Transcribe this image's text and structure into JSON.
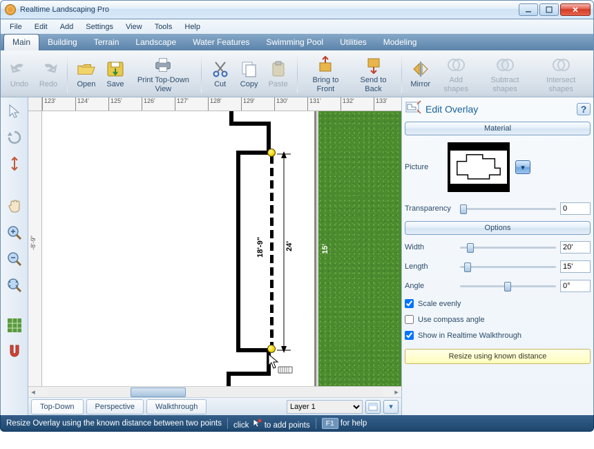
{
  "window": {
    "title": "Realtime Landscaping Pro"
  },
  "menu": {
    "items": [
      "File",
      "Edit",
      "Add",
      "Settings",
      "View",
      "Tools",
      "Help"
    ]
  },
  "ribbon_tabs": [
    "Main",
    "Building",
    "Terrain",
    "Landscape",
    "Water Features",
    "Swimming Pool",
    "Utilities",
    "Modeling"
  ],
  "active_ribbon_tab": 0,
  "ribbon": {
    "undo": "Undo",
    "redo": "Redo",
    "open": "Open",
    "save": "Save",
    "print": "Print Top-Down View",
    "cut": "Cut",
    "copy": "Copy",
    "paste": "Paste",
    "front": "Bring to Front",
    "back": "Send to Back",
    "mirror": "Mirror",
    "addshapes": "Add shapes",
    "subshapes": "Subtract shapes",
    "intshapes": "Intersect shapes"
  },
  "ruler": {
    "marks": [
      "123'",
      "124'",
      "125'",
      "126'",
      "127'",
      "128'",
      "129'",
      "130'",
      "131'",
      "132'",
      "133'"
    ],
    "vlabel": "-8'-9\""
  },
  "canvas": {
    "dim_main": "24'",
    "dim_inner": "18'-9\"",
    "dim_grass": "15'"
  },
  "viewtabs": {
    "items": [
      "Top-Down",
      "Perspective",
      "Walkthrough"
    ],
    "active": 0,
    "layer": "Layer 1"
  },
  "panel": {
    "title": "Edit Overlay",
    "group_material": "Material",
    "group_options": "Options",
    "picture_label": "Picture",
    "transparency_label": "Transparency",
    "transparency_value": "0",
    "width_label": "Width",
    "width_value": "20'",
    "length_label": "Length",
    "length_value": "15'",
    "angle_label": "Angle",
    "angle_value": "0°",
    "scale_evenly": "Scale evenly",
    "use_compass": "Use compass angle",
    "show_walk": "Show in Realtime Walkthrough",
    "resize_btn": "Resize using known distance"
  },
  "status": {
    "msg": "Resize Overlay using the known distance between two points",
    "click_text": "click",
    "add_points": "to add points",
    "f1": "F1",
    "for_help": "for help"
  }
}
